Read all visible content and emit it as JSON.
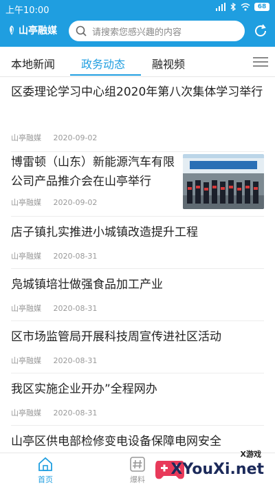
{
  "status": {
    "time": "上午10:00",
    "battery": "68"
  },
  "header": {
    "brand": "山亭融媒",
    "search_placeholder": "请搜索您感兴趣的内容"
  },
  "tabs": [
    {
      "label": "本地新闻",
      "active": false
    },
    {
      "label": "政务动态",
      "active": true
    },
    {
      "label": "融视频",
      "active": false
    }
  ],
  "news": [
    {
      "title": "区委理论学习中心组2020年第八次集体学习举行",
      "source": "山亭融媒",
      "date": "2020-09-02"
    },
    {
      "title": "博雷顿（山东）新能源汽车有限公司产品推介会在山亭举行",
      "source": "山亭融媒",
      "date": "2020-09-02",
      "has_image": true
    },
    {
      "title": "店子镇扎实推进小城镇改造提升工程",
      "source": "山亭融媒",
      "date": "2020-08-31"
    },
    {
      "title": "凫城镇培壮做强食品加工产业",
      "source": "山亭融媒",
      "date": "2020-08-31"
    },
    {
      "title": "区市场监管局开展科技周宣传进社区活动",
      "source": "山亭融媒",
      "date": "2020-08-31"
    },
    {
      "title": "我区实施企业开办”全程网办",
      "source": "山亭融媒",
      "date": "2020-08-31"
    },
    {
      "title": "山亭区供电部检修变电设备保障电网安全",
      "source": "",
      "date": ""
    }
  ],
  "bottom_nav": [
    {
      "label": "首页",
      "icon": "home-icon",
      "active": true
    },
    {
      "label": "爆料",
      "icon": "hash-icon",
      "active": false
    }
  ],
  "watermark": {
    "small": "X游戏",
    "big": "XYouXi.net"
  },
  "colors": {
    "accent": "#1f9ee0",
    "text": "#222222",
    "meta": "#999999"
  }
}
